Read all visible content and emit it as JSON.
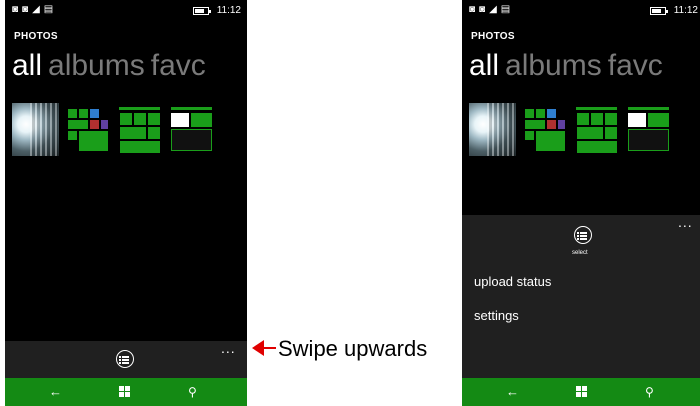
{
  "status_bar": {
    "time": "11:12"
  },
  "app": {
    "title": "PHOTOS"
  },
  "pivot": {
    "tabs": [
      "all",
      "albums",
      "favc"
    ]
  },
  "app_bar": {
    "more": "...",
    "select_label": "select"
  },
  "menu": {
    "items": [
      "upload status",
      "settings"
    ]
  },
  "navbar": {
    "back_icon": "back-arrow-icon",
    "start_icon": "windows-icon",
    "search_icon": "search-icon"
  },
  "annotation": {
    "text": "Swipe upwards",
    "color": "#e00000"
  },
  "colors": {
    "navbar": "#148a14",
    "appbar": "#202020",
    "tile_green": "#1a9e1a"
  }
}
